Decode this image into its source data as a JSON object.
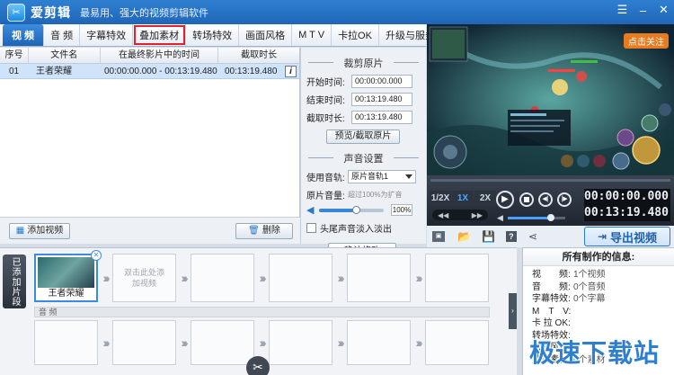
{
  "app": {
    "name": "爱剪辑",
    "slogan": "最易用、强大的视频剪辑软件"
  },
  "tabs": [
    {
      "label": "视 频",
      "active": true
    },
    {
      "label": "音 频"
    },
    {
      "label": "字幕特效"
    },
    {
      "label": "叠加素材",
      "highlight": true
    },
    {
      "label": "转场特效"
    },
    {
      "label": "画面风格"
    },
    {
      "label": "M T V"
    },
    {
      "label": "卡拉OK"
    },
    {
      "label": "升级与服务"
    }
  ],
  "list": {
    "headers": [
      "序号",
      "文件名",
      "在最终影片中的时间",
      "截取时长"
    ],
    "rows": [
      {
        "index": "01",
        "name": "王者荣耀",
        "time": "00:00:00.000 - 00:13:19.480",
        "duration": "00:13:19.480"
      }
    ]
  },
  "clip": {
    "title": "裁剪原片",
    "start_label": "开始时间:",
    "start": "00:00:00.000",
    "end_label": "结束时间:",
    "end": "00:13:19.480",
    "duration_label": "截取时长:",
    "duration": "00:13:19.480",
    "preview_btn": "预览/截取原片"
  },
  "audio": {
    "title": "声音设置",
    "track_label": "使用音轨:",
    "track": "原片音轨1",
    "volume_label": "原片音量:",
    "volume_hint": "超过100%为扩音",
    "volume_pct": "100%",
    "volume_level": 0.95,
    "fade_label": "头尾声音淡入淡出",
    "confirm_btn": "确认修改"
  },
  "actions": {
    "add_video": "添加视频",
    "delete": "删除"
  },
  "preview": {
    "banner": "点击关注"
  },
  "player": {
    "speeds": [
      "1/2X",
      "1X",
      "2X"
    ],
    "current_time": "00:00:00.000",
    "total_time": "00:13:19.480",
    "progress": 0.0,
    "volume_level": 0.75
  },
  "export_btn": "导出视频",
  "timeline": {
    "side_label": "已添加片段",
    "clip_name": "王者荣耀",
    "placeholder": "双击此处添加视频",
    "audio_label": "音 频"
  },
  "info": {
    "title": "所有制作的信息:",
    "rows": [
      {
        "k": "视　　频:",
        "v": "1个视频"
      },
      {
        "k": "音　　频:",
        "v": "0个音频"
      },
      {
        "k": "字幕特效:",
        "v": "0个字幕"
      },
      {
        "k": "M　T　V:",
        "v": ""
      },
      {
        "k": "卡 拉 OK:",
        "v": ""
      },
      {
        "k": "转场特效:",
        "v": ""
      },
      {
        "k": "画面风格:",
        "v": ""
      },
      {
        "k": "叠加素材:",
        "v": "0个素材"
      }
    ]
  },
  "watermark": "极速下载站",
  "colors": {
    "title_bar": "#2f7fd1",
    "highlight_border": "#e2222a",
    "selected_row": "#cfe3fb"
  }
}
